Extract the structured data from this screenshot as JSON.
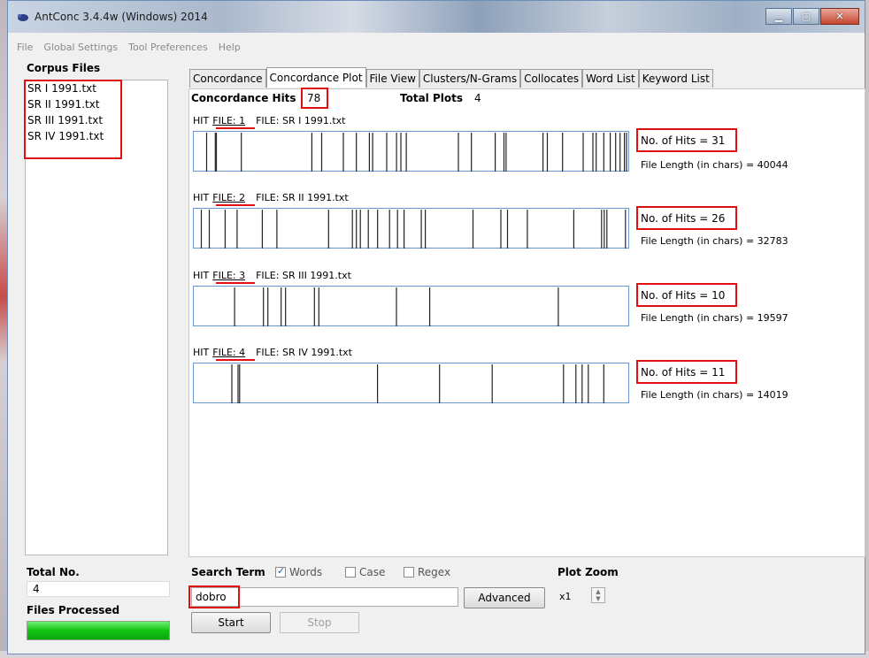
{
  "window": {
    "title": "AntConc 3.4.4w (Windows) 2014"
  },
  "menu": [
    "File",
    "Global Settings",
    "Tool Preferences",
    "Help"
  ],
  "corpus": {
    "label": "Corpus Files",
    "files": [
      "SR I 1991.txt",
      "SR II 1991.txt",
      "SR III 1991.txt",
      "SR IV 1991.txt"
    ],
    "total_label": "Total No.",
    "total_value": "4",
    "processed_label": "Files Processed",
    "progress": 1.0
  },
  "tabs": [
    "Concordance",
    "Concordance Plot",
    "File View",
    "Clusters/N-Grams",
    "Collocates",
    "Word List",
    "Keyword List"
  ],
  "active_tab": 1,
  "summary": {
    "hits_label": "Concordance Hits",
    "hits_value": "78",
    "plots_label": "Total Plots",
    "plots_value": "4"
  },
  "plots": [
    {
      "hit": "HIT",
      "file_label": "FILE: 1",
      "file_name": "FILE: SR I 1991.txt",
      "hits_text": "No. of Hits = 31",
      "length_text": "File Length (in chars) = 40044",
      "file_length": 40044,
      "positions": [
        1100,
        1900,
        2000,
        4300,
        10800,
        11700,
        13700,
        14900,
        16100,
        16400,
        17700,
        18600,
        19000,
        19500,
        24300,
        25500,
        27700,
        28500,
        28700,
        32100,
        32500,
        33900,
        35800,
        36700,
        37000,
        37700,
        38300,
        38800,
        39200,
        39600,
        39800
      ]
    },
    {
      "hit": "HIT",
      "file_label": "FILE: 2",
      "file_name": "FILE: SR II 1991.txt",
      "hits_text": "No. of Hits = 26",
      "length_text": "File Length (in chars) = 32783",
      "file_length": 32783,
      "positions": [
        500,
        1100,
        2300,
        3200,
        5100,
        6200,
        10100,
        11900,
        12200,
        12500,
        13100,
        13800,
        14700,
        15300,
        15800,
        17100,
        17400,
        21000,
        23100,
        23600,
        25100,
        28600,
        30700,
        30900,
        31100,
        32500
      ]
    },
    {
      "hit": "HIT",
      "file_label": "FILE: 3",
      "file_name": "FILE: SR III 1991.txt",
      "hits_text": "No. of Hits = 10",
      "length_text": "File Length (in chars) = 19597",
      "file_length": 19597,
      "positions": [
        1800,
        3100,
        3300,
        3900,
        4100,
        5400,
        5600,
        9100,
        10600,
        16400
      ]
    },
    {
      "hit": "HIT",
      "file_label": "FILE: 4",
      "file_name": "FILE: SR IV 1991.txt",
      "hits_text": "No. of Hits = 11",
      "length_text": "File Length (in chars) = 14019",
      "file_length": 14019,
      "positions": [
        1200,
        1400,
        1450,
        5900,
        7900,
        9600,
        11900,
        12300,
        12500,
        12700,
        13200
      ]
    }
  ],
  "search": {
    "label": "Search Term",
    "words_label": "Words",
    "case_label": "Case",
    "regex_label": "Regex",
    "words_checked": true,
    "case_checked": false,
    "regex_checked": false,
    "value": "dobro",
    "advanced_label": "Advanced",
    "start_label": "Start",
    "stop_label": "Stop"
  },
  "zoom": {
    "label": "Plot Zoom",
    "value": "x1"
  }
}
